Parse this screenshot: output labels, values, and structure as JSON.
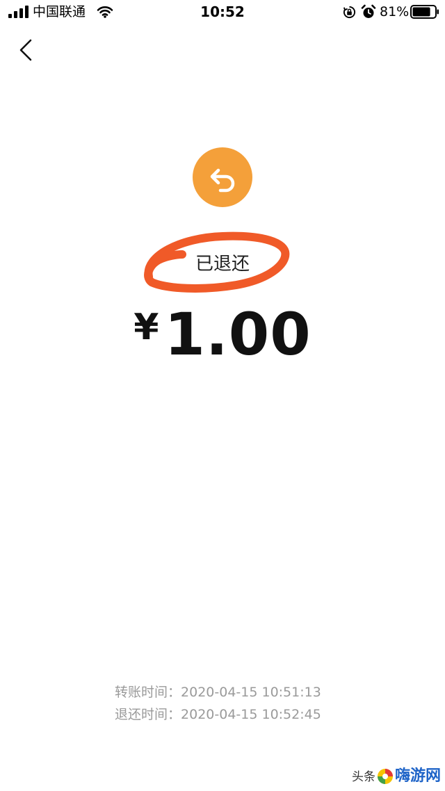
{
  "status_bar": {
    "carrier": "中国联通",
    "time": "10:52",
    "battery": "81%",
    "battery_level": 0.81
  },
  "nav": {
    "back_icon": "chevron-left-icon"
  },
  "refund": {
    "icon": "undo-arrow-icon",
    "status": "已退还",
    "currency": "¥",
    "amount": "1.00",
    "colors": {
      "icon_bg": "#f4a03a",
      "annotation": "#f05a28"
    }
  },
  "times": [
    {
      "label": "转账时间：",
      "value": "2020-04-15 10:51:13"
    },
    {
      "label": "退还时间：",
      "value": "2020-04-15 10:52:45"
    }
  ],
  "watermark": {
    "prefix": "头条",
    "brand": "嗨游网"
  }
}
